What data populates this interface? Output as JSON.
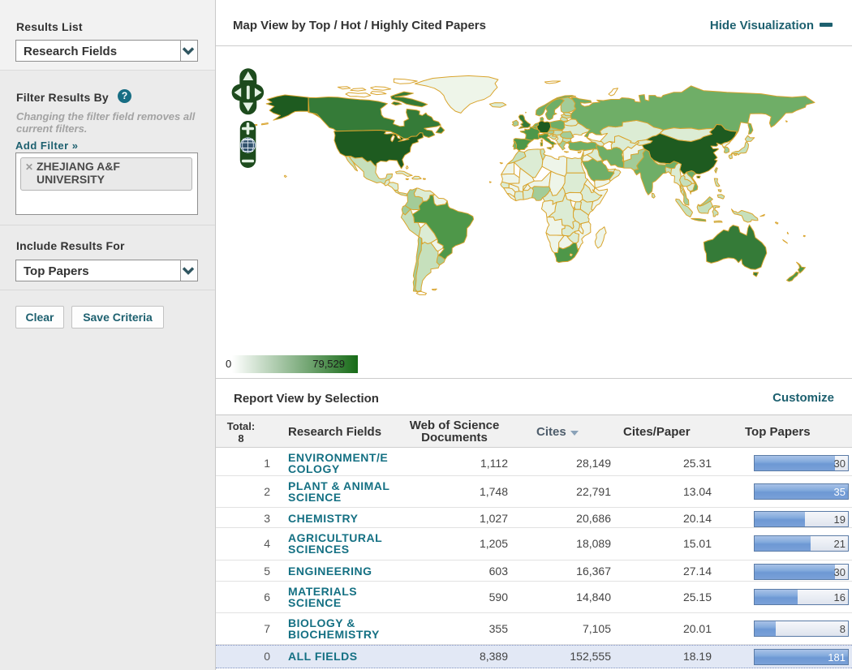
{
  "sidebar": {
    "results_list_label": "Results List",
    "results_list_value": "Research Fields",
    "filter_by_label": "Filter Results By",
    "help_icon_glyph": "?",
    "filter_note": "Changing the filter field removes all current filters.",
    "add_filter_label": "Add Filter »",
    "filter_chip": {
      "remove_icon_glyph": "✕",
      "label": "ZHEJIANG A&F UNIVERSITY"
    },
    "include_results_label": "Include Results For",
    "include_results_value": "Top Papers",
    "clear_button": "Clear",
    "save_button": "Save Criteria"
  },
  "map_panel": {
    "title": "Map View by Top / Hot / Highly Cited Papers",
    "hide_link": "Hide Visualization",
    "legend": {
      "min": "0",
      "max": "79,529"
    },
    "colors": {
      "border": "#d9a42d",
      "ocean": "#ffffff",
      "scale_low": "#ffffff",
      "scale_high": "#176b17",
      "control_green": "#1d4e1f",
      "accent_teal": "#1d606f"
    }
  },
  "report": {
    "title": "Report View by Selection",
    "customize_link": "Customize",
    "table": {
      "total_label": "Total:",
      "total_value": "8",
      "columns": {
        "research_fields": "Research Fields",
        "wos_documents": "Web of Science Documents",
        "cites": "Cites",
        "cites_per_paper": "Cites/Paper",
        "top_papers": "Top Papers"
      },
      "sorted_column": "Cites",
      "sort_direction": "desc",
      "rows": [
        {
          "rank": "1",
          "field": "ENVIRONMENT/E\nCOLOGY",
          "wos_documents": "1,112",
          "cites": "28,149",
          "cites_per_paper": "25.31",
          "top_papers": "30",
          "bar_pct": 85.7,
          "highlight": false,
          "tall": true
        },
        {
          "rank": "2",
          "field": "PLANT & ANIMAL\nSCIENCE",
          "wos_documents": "1,748",
          "cites": "22,791",
          "cites_per_paper": "13.04",
          "top_papers": "35",
          "bar_pct": 100,
          "highlight": false,
          "tall": true
        },
        {
          "rank": "3",
          "field": "CHEMISTRY",
          "wos_documents": "1,027",
          "cites": "20,686",
          "cites_per_paper": "20.14",
          "top_papers": "19",
          "bar_pct": 54.3,
          "highlight": false,
          "tall": false
        },
        {
          "rank": "4",
          "field": "AGRICULTURAL\nSCIENCES",
          "wos_documents": "1,205",
          "cites": "18,089",
          "cites_per_paper": "15.01",
          "top_papers": "21",
          "bar_pct": 60,
          "highlight": false,
          "tall": true
        },
        {
          "rank": "5",
          "field": "ENGINEERING",
          "wos_documents": "603",
          "cites": "16,367",
          "cites_per_paper": "27.14",
          "top_papers": "30",
          "bar_pct": 85.7,
          "highlight": false,
          "tall": false
        },
        {
          "rank": "6",
          "field": "MATERIALS\nSCIENCE",
          "wos_documents": "590",
          "cites": "14,840",
          "cites_per_paper": "25.15",
          "top_papers": "16",
          "bar_pct": 45.7,
          "highlight": false,
          "tall": true
        },
        {
          "rank": "7",
          "field": "BIOLOGY &\nBIOCHEMISTRY",
          "wos_documents": "355",
          "cites": "7,105",
          "cites_per_paper": "20.01",
          "top_papers": "8",
          "bar_pct": 22.9,
          "highlight": false,
          "tall": true
        },
        {
          "rank": "0",
          "field": "ALL FIELDS",
          "wos_documents": "8,389",
          "cites": "152,555",
          "cites_per_paper": "18.19",
          "top_papers": "181",
          "bar_pct": 100,
          "highlight": true,
          "tall": false
        }
      ]
    }
  }
}
